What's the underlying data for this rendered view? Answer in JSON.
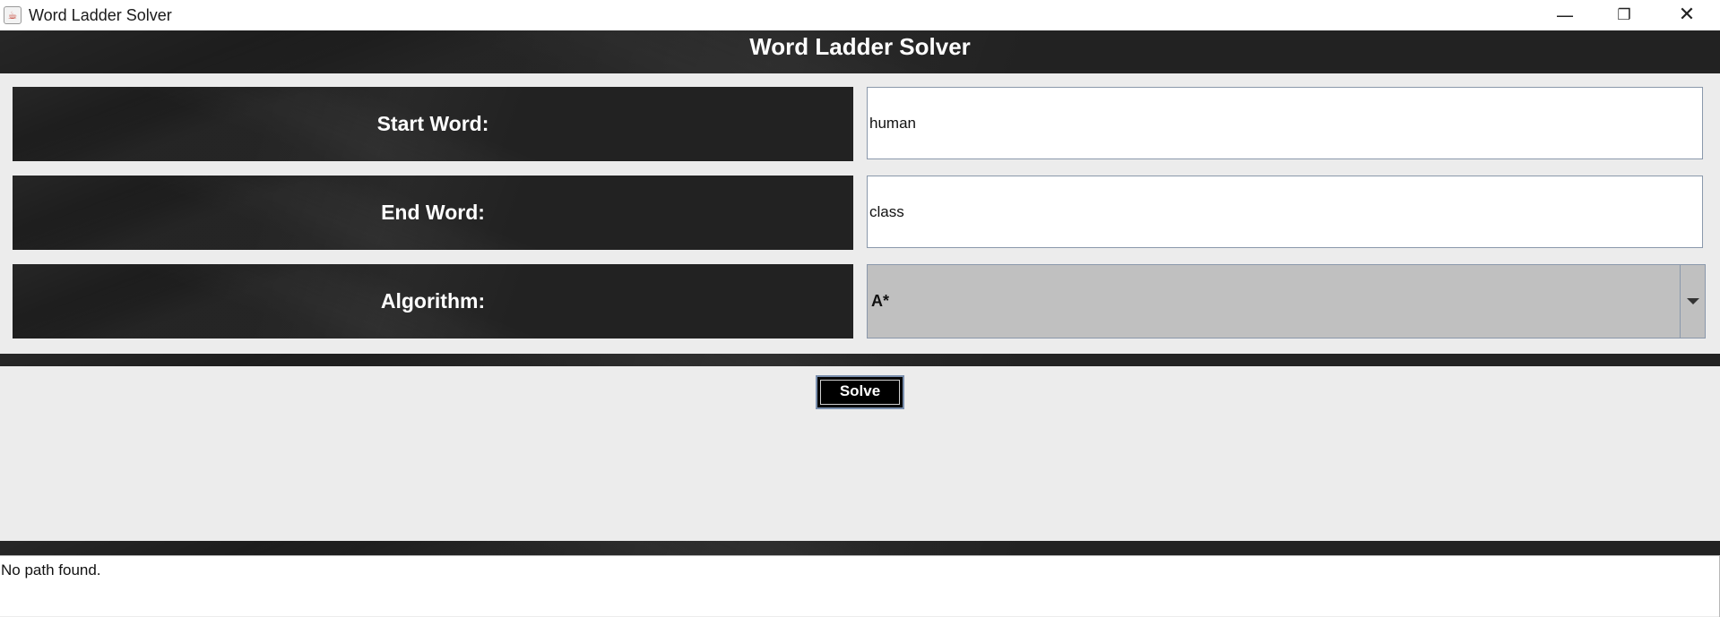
{
  "window": {
    "title": "Word Ladder Solver",
    "icon": "java-cup-icon",
    "controls": {
      "minimize": "—",
      "maximize": "❐",
      "close": "✕"
    }
  },
  "header": {
    "title": "Word Ladder Solver"
  },
  "form": {
    "start_label": "Start Word:",
    "start_value": "human",
    "end_label": "End Word:",
    "end_value": "class",
    "algorithm_label": "Algorithm:",
    "algorithm_value": "A*"
  },
  "actions": {
    "solve_label": "Solve"
  },
  "output": {
    "text": "No path found."
  },
  "colors": {
    "panel_dark": "#0d0d0d",
    "background": "#ececec",
    "select_bg": "#c0c0c0",
    "field_border": "#8a98ab",
    "button_border": "#7a8fae"
  }
}
